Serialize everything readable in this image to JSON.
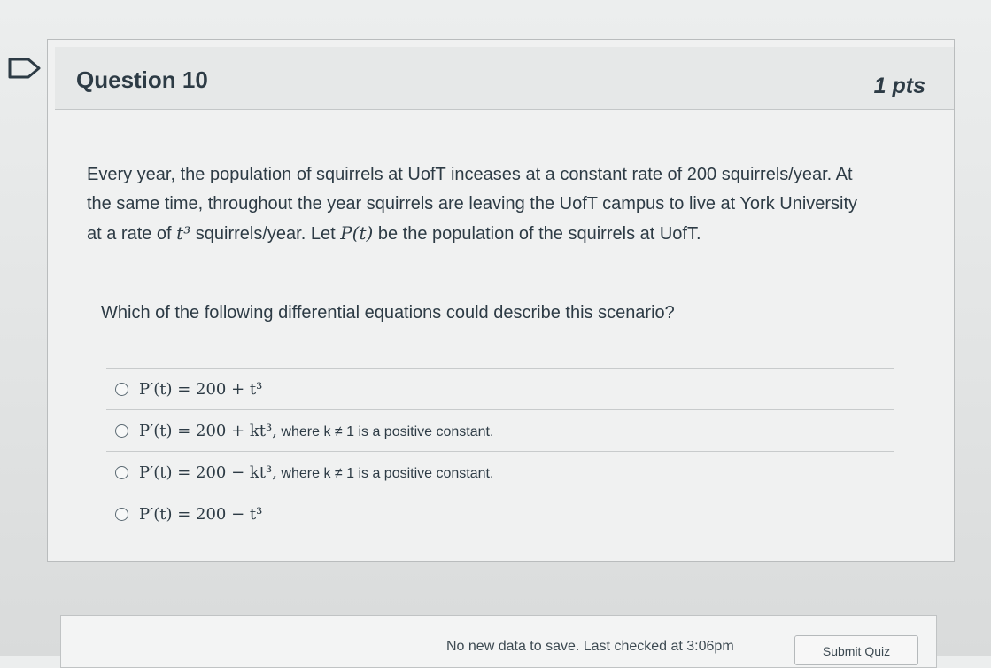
{
  "question": {
    "title": "Question 10",
    "points": "1 pts",
    "text_line1": "Every year, the population of squirrels at UofT inceases at a constant rate of 200 squirrels/year. At",
    "text_line2": "the same time, throughout the year squirrels are leaving the UofT campus to live at York University",
    "text_line3_a": "at a rate of ",
    "text_line3_b": " squirrels/year. Let ",
    "text_line3_c": " be the population of the squirrels at UofT.",
    "math_t3": "t³",
    "math_Pt": "P(t)",
    "prompt": "Which of the following differential equations could describe this scenario?",
    "answers": [
      {
        "equation": "P′(t) = 200 + t³",
        "note": ""
      },
      {
        "equation": "P′(t) = 200 + kt³,",
        "note": " where k ≠ 1 is a positive constant."
      },
      {
        "equation": "P′(t) = 200 − kt³,",
        "note": " where k ≠ 1 is a positive constant."
      },
      {
        "equation": "P′(t) = 200 − t³",
        "note": ""
      }
    ]
  },
  "footer": {
    "save_status": "No new data to save. Last checked at 3:06pm",
    "submit_label": "Submit Quiz"
  },
  "colors": {
    "text": "#2d3b45",
    "background": "#e6e8e8"
  }
}
